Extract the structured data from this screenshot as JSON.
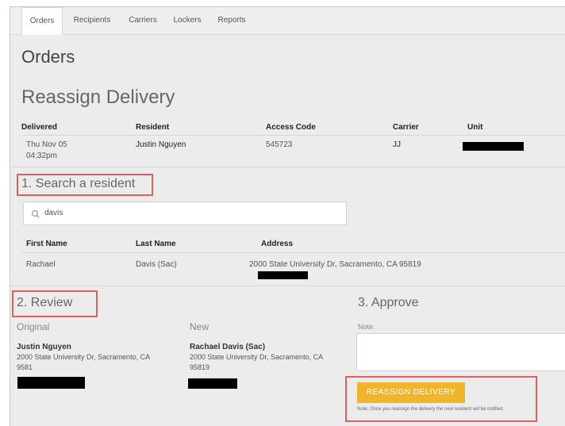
{
  "tabs": [
    "Orders",
    "Recipients",
    "Carriers",
    "Lockers",
    "Reports"
  ],
  "page_title": "Orders",
  "section_title": "Reassign Delivery",
  "delivery_table": {
    "headers": [
      "Delivered",
      "Resident",
      "Access Code",
      "Carrier",
      "Unit"
    ],
    "row": {
      "delivered_line1": "Thu Nov 05",
      "delivered_line2": "04:32pm",
      "resident": "Justin Nguyen",
      "access_code": "545723",
      "carrier": "JJ"
    }
  },
  "step1": {
    "title": "1. Search a resident",
    "search_value": "davis"
  },
  "results_table": {
    "headers": [
      "First Name",
      "Last Name",
      "Address"
    ],
    "row": {
      "first_name": "Rachael",
      "last_name": "Davis (Sac)",
      "address": "2000 State University Dr, Sacramento, CA 95819"
    }
  },
  "step2": {
    "title": "2. Review",
    "original_label": "Original",
    "original_name": "Justin Nguyen",
    "original_addr1": "2000 State University Dr, Sacramento, CA",
    "original_addr2": "9581",
    "new_label": "New",
    "new_name": "Rachael Davis (Sac)",
    "new_addr1": "2000 State University Dr, Sacramento, CA",
    "new_addr2": "95819"
  },
  "step3": {
    "title": "3. Approve",
    "note_label": "Note:",
    "button_label": "REASSIGN DELIVERY",
    "button_note": "Note: Once you reassign the delivery the new resident will be notified."
  },
  "colors": {
    "accent": "#f0b52b",
    "highlight": "#e06060",
    "background": "#ececec"
  }
}
